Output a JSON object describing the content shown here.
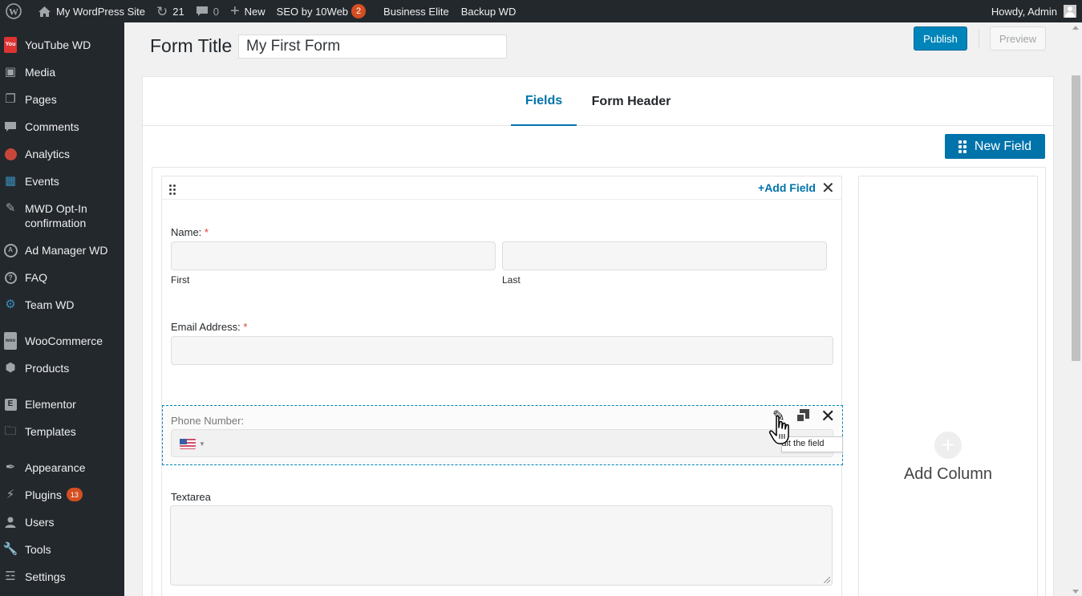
{
  "adminbar": {
    "site_name": "My WordPress Site",
    "updates_count": "21",
    "comments_count": "0",
    "new_label": "New",
    "seo_label": "SEO by 10Web",
    "seo_badge": "2",
    "business_label": "Business Elite",
    "backup_label": "Backup WD",
    "howdy": "Howdy, Admin"
  },
  "sidebar": {
    "items": [
      {
        "label": "YouTube WD",
        "icon": "youtube-icon"
      },
      {
        "label": "Media",
        "icon": "media-icon"
      },
      {
        "label": "Pages",
        "icon": "pages-icon"
      },
      {
        "label": "Comments",
        "icon": "comments-icon"
      },
      {
        "label": "Analytics",
        "icon": "analytics-icon"
      },
      {
        "label": "Events",
        "icon": "events-icon"
      },
      {
        "label": "MWD Opt-In confirmation",
        "icon": "pin-icon"
      },
      {
        "label": "Ad Manager WD",
        "icon": "ad-manager-icon"
      },
      {
        "label": "FAQ",
        "icon": "faq-icon"
      },
      {
        "label": "Team WD",
        "icon": "team-icon"
      },
      {
        "label": "WooCommerce",
        "icon": "woocommerce-icon"
      },
      {
        "label": "Products",
        "icon": "products-icon"
      },
      {
        "label": "Elementor",
        "icon": "elementor-icon"
      },
      {
        "label": "Templates",
        "icon": "folder-icon"
      },
      {
        "label": "Appearance",
        "icon": "appearance-icon"
      },
      {
        "label": "Plugins",
        "icon": "plugins-icon",
        "badge": "13"
      },
      {
        "label": "Users",
        "icon": "users-icon"
      },
      {
        "label": "Tools",
        "icon": "tools-icon"
      },
      {
        "label": "Settings",
        "icon": "settings-icon"
      }
    ]
  },
  "header": {
    "form_title_label": "Form Title",
    "form_title_value": "My First Form",
    "publish_label": "Publish",
    "preview_label": "Preview"
  },
  "tabs": [
    {
      "label": "Fields",
      "active": true
    },
    {
      "label": "Form Header",
      "active": false
    }
  ],
  "new_field_label": "New Field",
  "column": {
    "add_field_label": "Add Field",
    "fields": {
      "name": {
        "label": "Name:",
        "required": "*",
        "first": "First",
        "last": "Last"
      },
      "email": {
        "label": "Email Address:",
        "required": "*"
      },
      "phone": {
        "label": "Phone Number:",
        "tooltip": "Edit the field"
      },
      "textarea": {
        "label": "Textarea"
      }
    }
  },
  "add_column_label": "Add Column",
  "colors": {
    "accent": "#0073aa",
    "admin_bg": "#23282d",
    "badge": "#d54e21",
    "required": "#dd3d36"
  }
}
